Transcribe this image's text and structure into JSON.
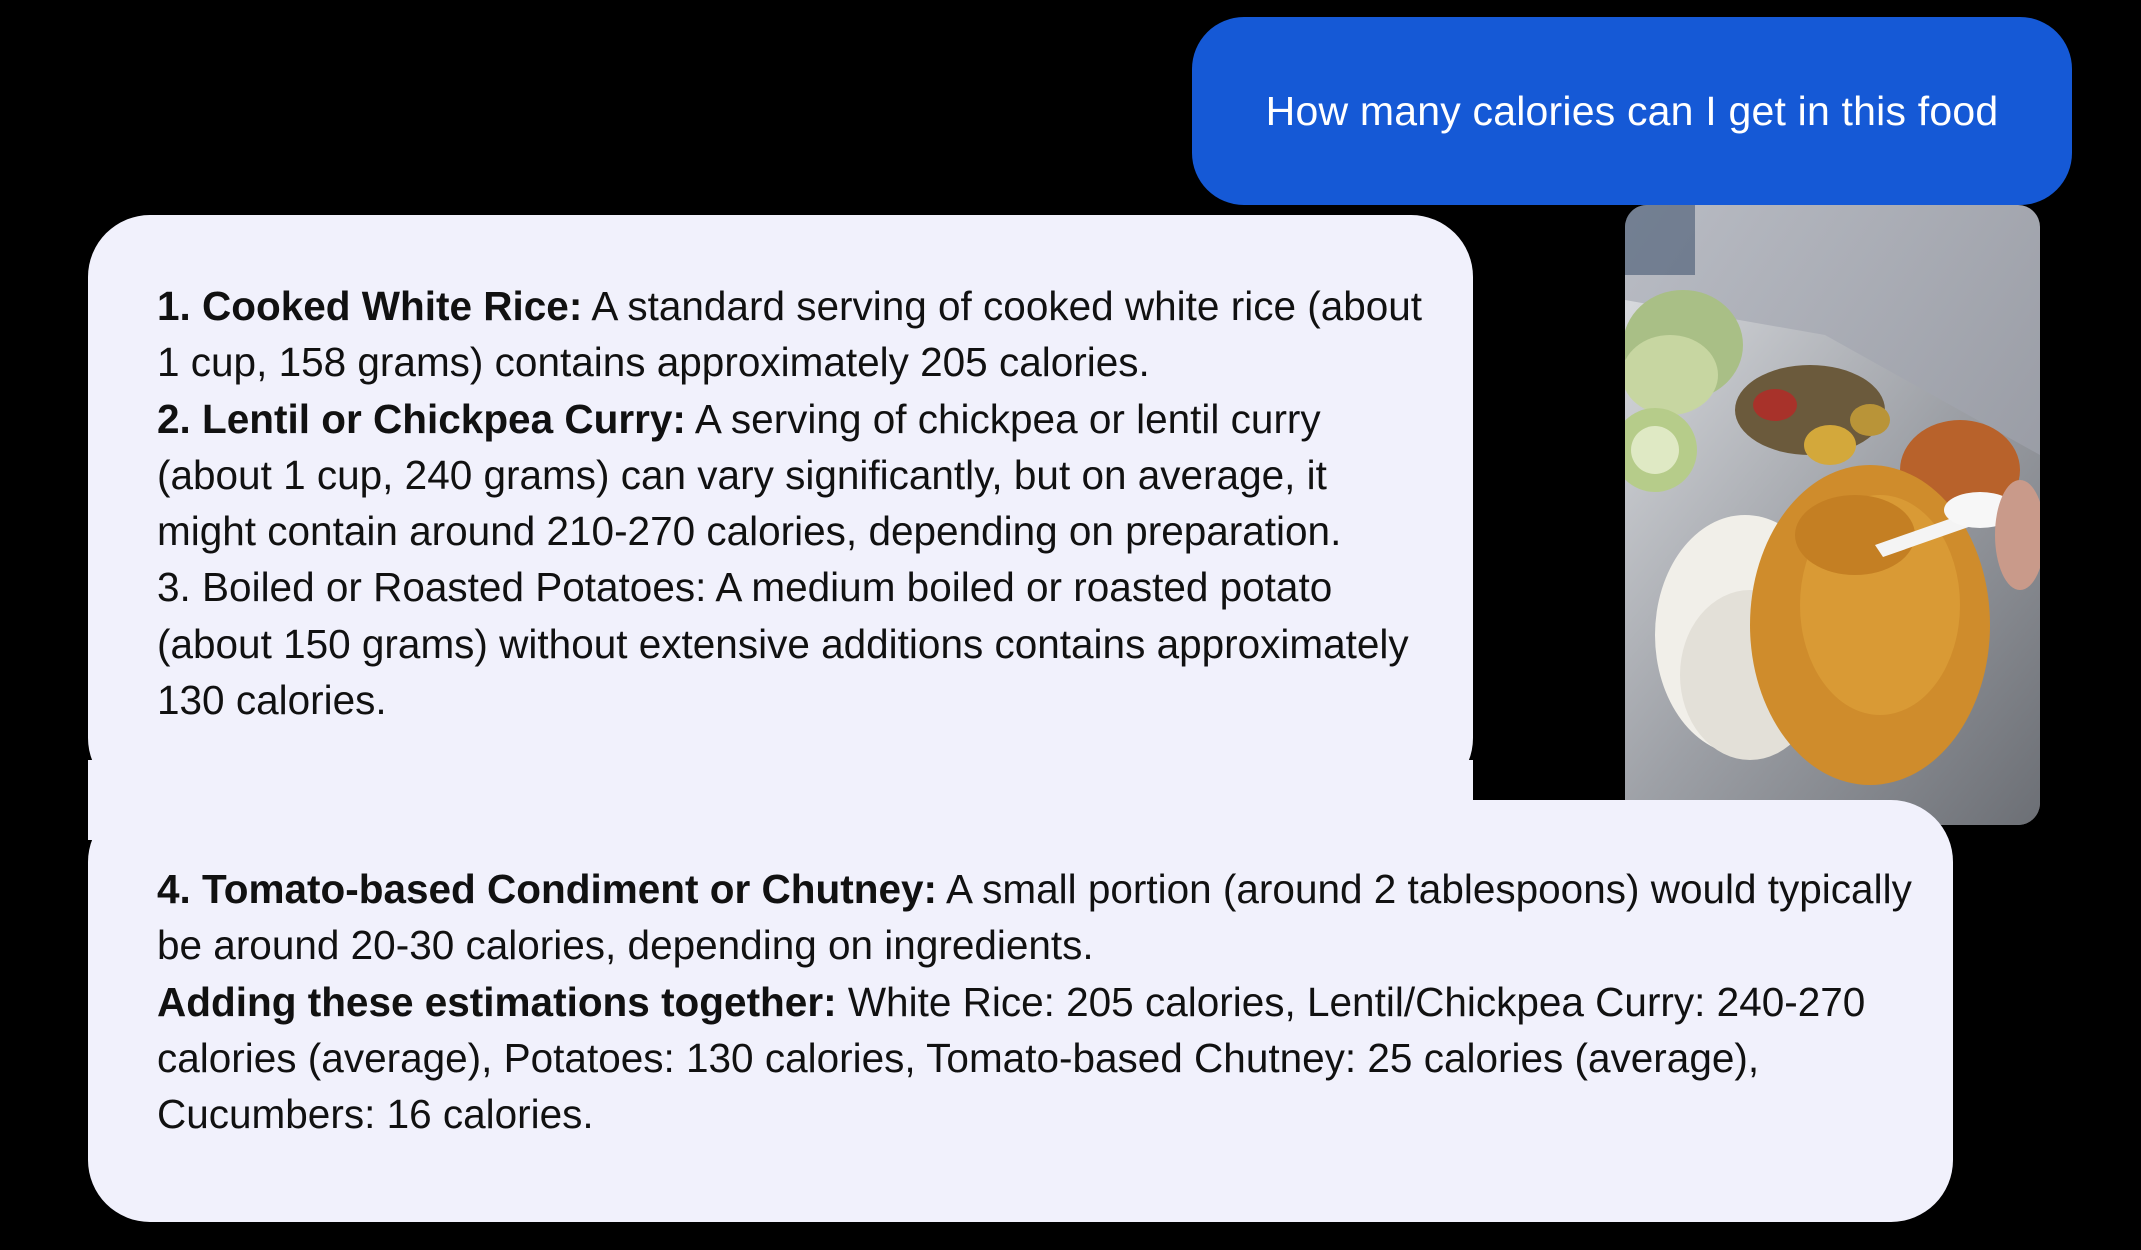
{
  "user_message": {
    "text": "How many calories can I get in this food"
  },
  "attachment": {
    "description_icon": "food-tray-photo"
  },
  "reply": {
    "items": [
      {
        "label": "1. Cooked White Rice:",
        "text": " A standard serving of cooked white rice (about 1 cup, 158 grams) contains approximately 205 calories."
      },
      {
        "label": "2. Lentil or Chickpea Curry:",
        "text": " A serving of chickpea or lentil curry (about 1 cup, 240 grams) can vary significantly, but on average, it might contain around 210-270 calories, depending on preparation."
      },
      {
        "label": "",
        "text": "3. Boiled or Roasted Potatoes: A medium boiled or roasted potato (about 150 grams) without extensive additions contains approximately 130 calories."
      },
      {
        "label": "4. Tomato-based Condiment or Chutney:",
        "text": " A small portion (around 2 tablespoons) would typically be around 20-30 calories, depending on ingredients."
      },
      {
        "label": "Adding these estimations together:",
        "text": " White Rice: 205 calories, Lentil/Chickpea Curry: 240-270 calories (average), Potatoes: 130 calories, Tomato-based Chutney: 25 calories (average), Cucumbers: 16 calories."
      }
    ]
  },
  "colors": {
    "background": "#000000",
    "user_bubble": "#1559d6",
    "reply_bubble": "#f1f1fc",
    "reply_text": "#111111"
  }
}
